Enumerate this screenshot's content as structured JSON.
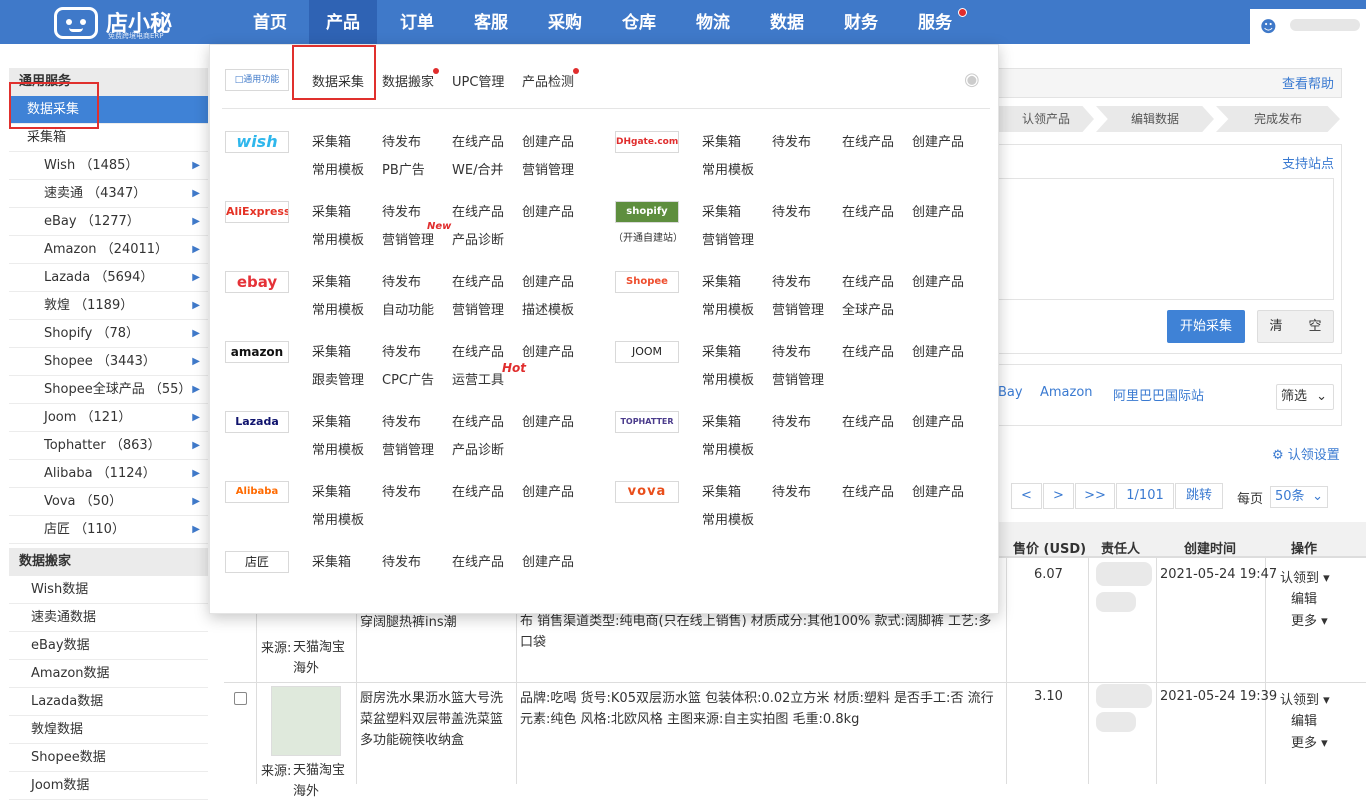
{
  "header": {
    "logo_title": "店小秘",
    "logo_sub": "免费跨境电商ERP",
    "nav": [
      "首页",
      "产品",
      "订单",
      "客服",
      "采购",
      "仓库",
      "物流",
      "数据",
      "财务",
      "服务"
    ]
  },
  "sidebar": {
    "group1": "通用服务",
    "active": "数据采集",
    "collect_box": "采集箱",
    "items": [
      "Wish （1485）",
      "速卖通 （4347）",
      "eBay （1277）",
      "Amazon （24011）",
      "Lazada （5694）",
      "敦煌 （1189）",
      "Shopify （78）",
      "Shopee （3443）",
      "Shopee全球产品 （55）",
      "Joom （121）",
      "Tophatter （863）",
      "Alibaba （1124）",
      "Vova （50）",
      "店匠 （110）"
    ],
    "group2": "数据搬家",
    "items2": [
      "Wish数据",
      "速卖通数据",
      "eBay数据",
      "Amazon数据",
      "Lazada数据",
      "敦煌数据",
      "Shopee数据",
      "Joom数据"
    ]
  },
  "dropdown": {
    "general_label": "通用功能",
    "tabs": [
      "数据采集",
      "数据搬家",
      "UPC管理",
      "产品检测"
    ],
    "platforms_left": [
      {
        "name": "wish",
        "actions": [
          "采集箱",
          "待发布",
          "在线产品",
          "创建产品",
          "常用模板",
          "PB广告",
          "WE/合并",
          "营销管理"
        ]
      },
      {
        "name": "AliExpress",
        "actions": [
          "采集箱",
          "待发布",
          "在线产品",
          "创建产品",
          "常用模板",
          "营销管理",
          "产品诊断"
        ]
      },
      {
        "name": "ebay",
        "actions": [
          "采集箱",
          "待发布",
          "在线产品",
          "创建产品",
          "常用模板",
          "自动功能",
          "营销管理",
          "描述模板"
        ]
      },
      {
        "name": "amazon",
        "actions": [
          "采集箱",
          "待发布",
          "在线产品",
          "创建产品",
          "跟卖管理",
          "CPC广告",
          "运营工具"
        ]
      },
      {
        "name": "Lazada",
        "actions": [
          "采集箱",
          "待发布",
          "在线产品",
          "创建产品",
          "常用模板",
          "营销管理",
          "产品诊断"
        ]
      },
      {
        "name": "Alibaba",
        "actions": [
          "采集箱",
          "待发布",
          "在线产品",
          "创建产品",
          "常用模板"
        ]
      },
      {
        "name": "店匠",
        "actions": [
          "采集箱",
          "待发布",
          "在线产品",
          "创建产品"
        ]
      }
    ],
    "platforms_right": [
      {
        "name": "DHgate.com",
        "actions": [
          "采集箱",
          "待发布",
          "在线产品",
          "创建产品",
          "常用模板"
        ]
      },
      {
        "name": "shopify",
        "note": "（开通自建站）",
        "actions": [
          "采集箱",
          "待发布",
          "在线产品",
          "创建产品",
          "营销管理"
        ]
      },
      {
        "name": "Shopee",
        "actions": [
          "采集箱",
          "待发布",
          "在线产品",
          "创建产品",
          "常用模板",
          "营销管理",
          "全球产品"
        ]
      },
      {
        "name": "JOOM",
        "actions": [
          "采集箱",
          "待发布",
          "在线产品",
          "创建产品",
          "常用模板",
          "营销管理"
        ]
      },
      {
        "name": "TOPHATTER",
        "actions": [
          "采集箱",
          "待发布",
          "在线产品",
          "创建产品",
          "常用模板"
        ]
      },
      {
        "name": "vova",
        "actions": [
          "采集箱",
          "待发布",
          "在线产品",
          "创建产品",
          "常用模板"
        ]
      }
    ],
    "tag_new": "New",
    "tag_hot": "Hot"
  },
  "main": {
    "help": "查看帮助",
    "steps": [
      "认领产品",
      "编辑数据",
      "完成发布"
    ],
    "support_sites": "支持站点",
    "start_btn": "开始采集",
    "clear_btn": "清　　空",
    "site_links": [
      "Bay",
      "Amazon",
      "阿里巴巴国际站"
    ],
    "filter": "筛选",
    "claim_settings": "认领设置",
    "pager": {
      "prev": "<",
      "next": ">",
      "last": ">>",
      "page": "1/101",
      "jump": "跳转",
      "per_page_label": "每页",
      "per_page": "50条"
    },
    "table_headers": [
      "售价 (USD)",
      "责任人",
      "创建时间",
      "操作"
    ],
    "rows": [
      {
        "title": "穿阔腿热裤ins潮",
        "source_label": "来源:",
        "source": "天猫淘宝海外",
        "attrs": "布 销售渠道类型:纯电商(只在线上销售) 材质成分:其他100% 款式:阔脚裤 工艺:多口袋",
        "price": "6.07",
        "time": "2021-05-24 19:47",
        "ops": [
          "认领到",
          "编辑",
          "更多"
        ]
      },
      {
        "title": "厨房洗水果沥水篮大号洗菜盆塑料双层带盖洗菜篮多功能碗筷收纳盒",
        "source_label": "来源:",
        "source": "天猫淘宝海外",
        "attrs": "品牌:吃喝 货号:K05双层沥水篮 包装体积:0.02立方米 材质:塑料 是否手工:否 流行元素:纯色 风格:北欧风格 主图来源:自主实拍图 毛重:0.8kg",
        "price": "3.10",
        "time": "2021-05-24 19:39",
        "ops": [
          "认领到",
          "编辑",
          "更多"
        ]
      }
    ]
  }
}
